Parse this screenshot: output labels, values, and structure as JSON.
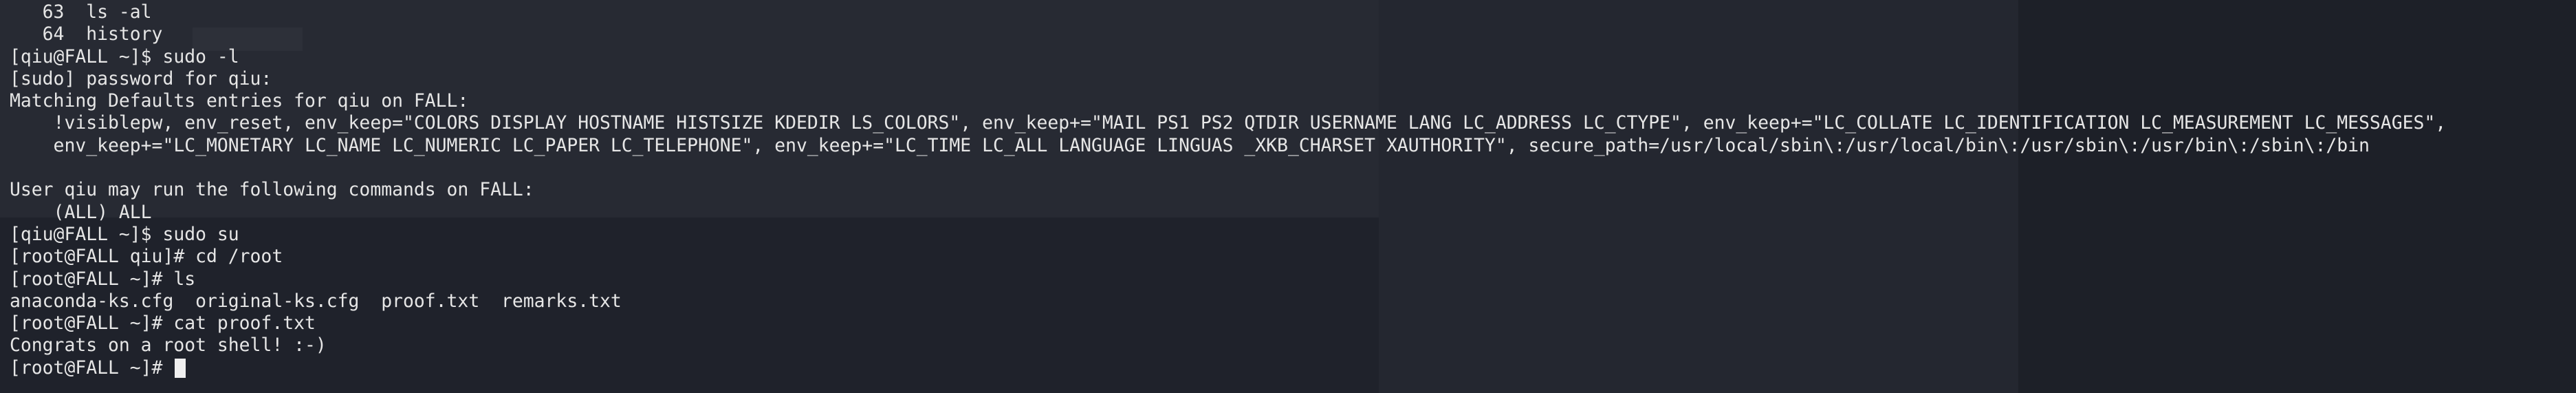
{
  "terminal": {
    "lines": [
      "   63  ls -al",
      "   64  history",
      "[qiu@FALL ~]$ sudo -l",
      "[sudo] password for qiu:",
      "Matching Defaults entries for qiu on FALL:",
      "    !visiblepw, env_reset, env_keep=\"COLORS DISPLAY HOSTNAME HISTSIZE KDEDIR LS_COLORS\", env_keep+=\"MAIL PS1 PS2 QTDIR USERNAME LANG LC_ADDRESS LC_CTYPE\", env_keep+=\"LC_COLLATE LC_IDENTIFICATION LC_MEASUREMENT LC_MESSAGES\",",
      "    env_keep+=\"LC_MONETARY LC_NAME LC_NUMERIC LC_PAPER LC_TELEPHONE\", env_keep+=\"LC_TIME LC_ALL LANGUAGE LINGUAS _XKB_CHARSET XAUTHORITY\", secure_path=/usr/local/sbin\\:/usr/local/bin\\:/usr/sbin\\:/usr/bin\\:/sbin\\:/bin",
      "",
      "User qiu may run the following commands on FALL:",
      "    (ALL) ALL",
      "[qiu@FALL ~]$ sudo su",
      "[root@FALL qiu]# cd /root",
      "[root@FALL ~]# ls",
      "anaconda-ks.cfg  original-ks.cfg  proof.txt  remarks.txt",
      "[root@FALL ~]# cat proof.txt",
      "Congrats on a root shell! :-)"
    ],
    "prompt": "[root@FALL ~]# "
  },
  "colors": {
    "background": "#1f222b",
    "text": "#e6e6e6",
    "cursor": "#f0f0f0"
  }
}
